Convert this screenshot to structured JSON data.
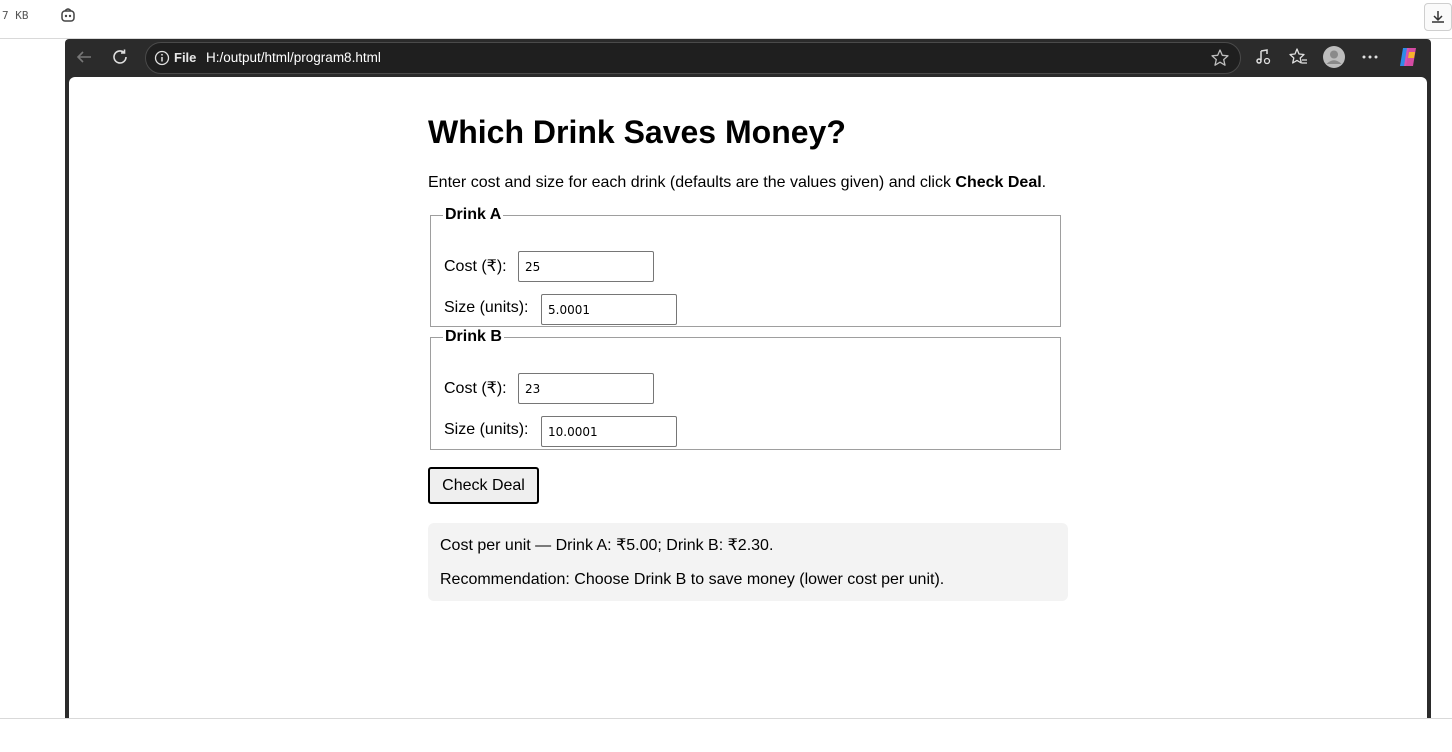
{
  "outer": {
    "size_text": "7 KB"
  },
  "address_bar": {
    "scheme_label": "File",
    "url": "H:/output/html/program8.html"
  },
  "page": {
    "title": "Which Drink Saves Money?",
    "intro_before": "Enter cost and size for each drink (defaults are the values given) and click ",
    "intro_bold": "Check Deal",
    "intro_after": ".",
    "drink_a": {
      "legend": "Drink A",
      "cost_label": "Cost (₹):",
      "cost_value": "25",
      "size_label": "Size (units):",
      "size_value": "5.0001"
    },
    "drink_b": {
      "legend": "Drink B",
      "cost_label": "Cost (₹):",
      "cost_value": "23",
      "size_label": "Size (units):",
      "size_value": "10.0001"
    },
    "button_label": "Check Deal",
    "result": {
      "line1": "Cost per unit — Drink A: ₹5.00; Drink B: ₹2.30.",
      "line2": "Recommendation: Choose Drink B to save money (lower cost per unit)."
    }
  }
}
